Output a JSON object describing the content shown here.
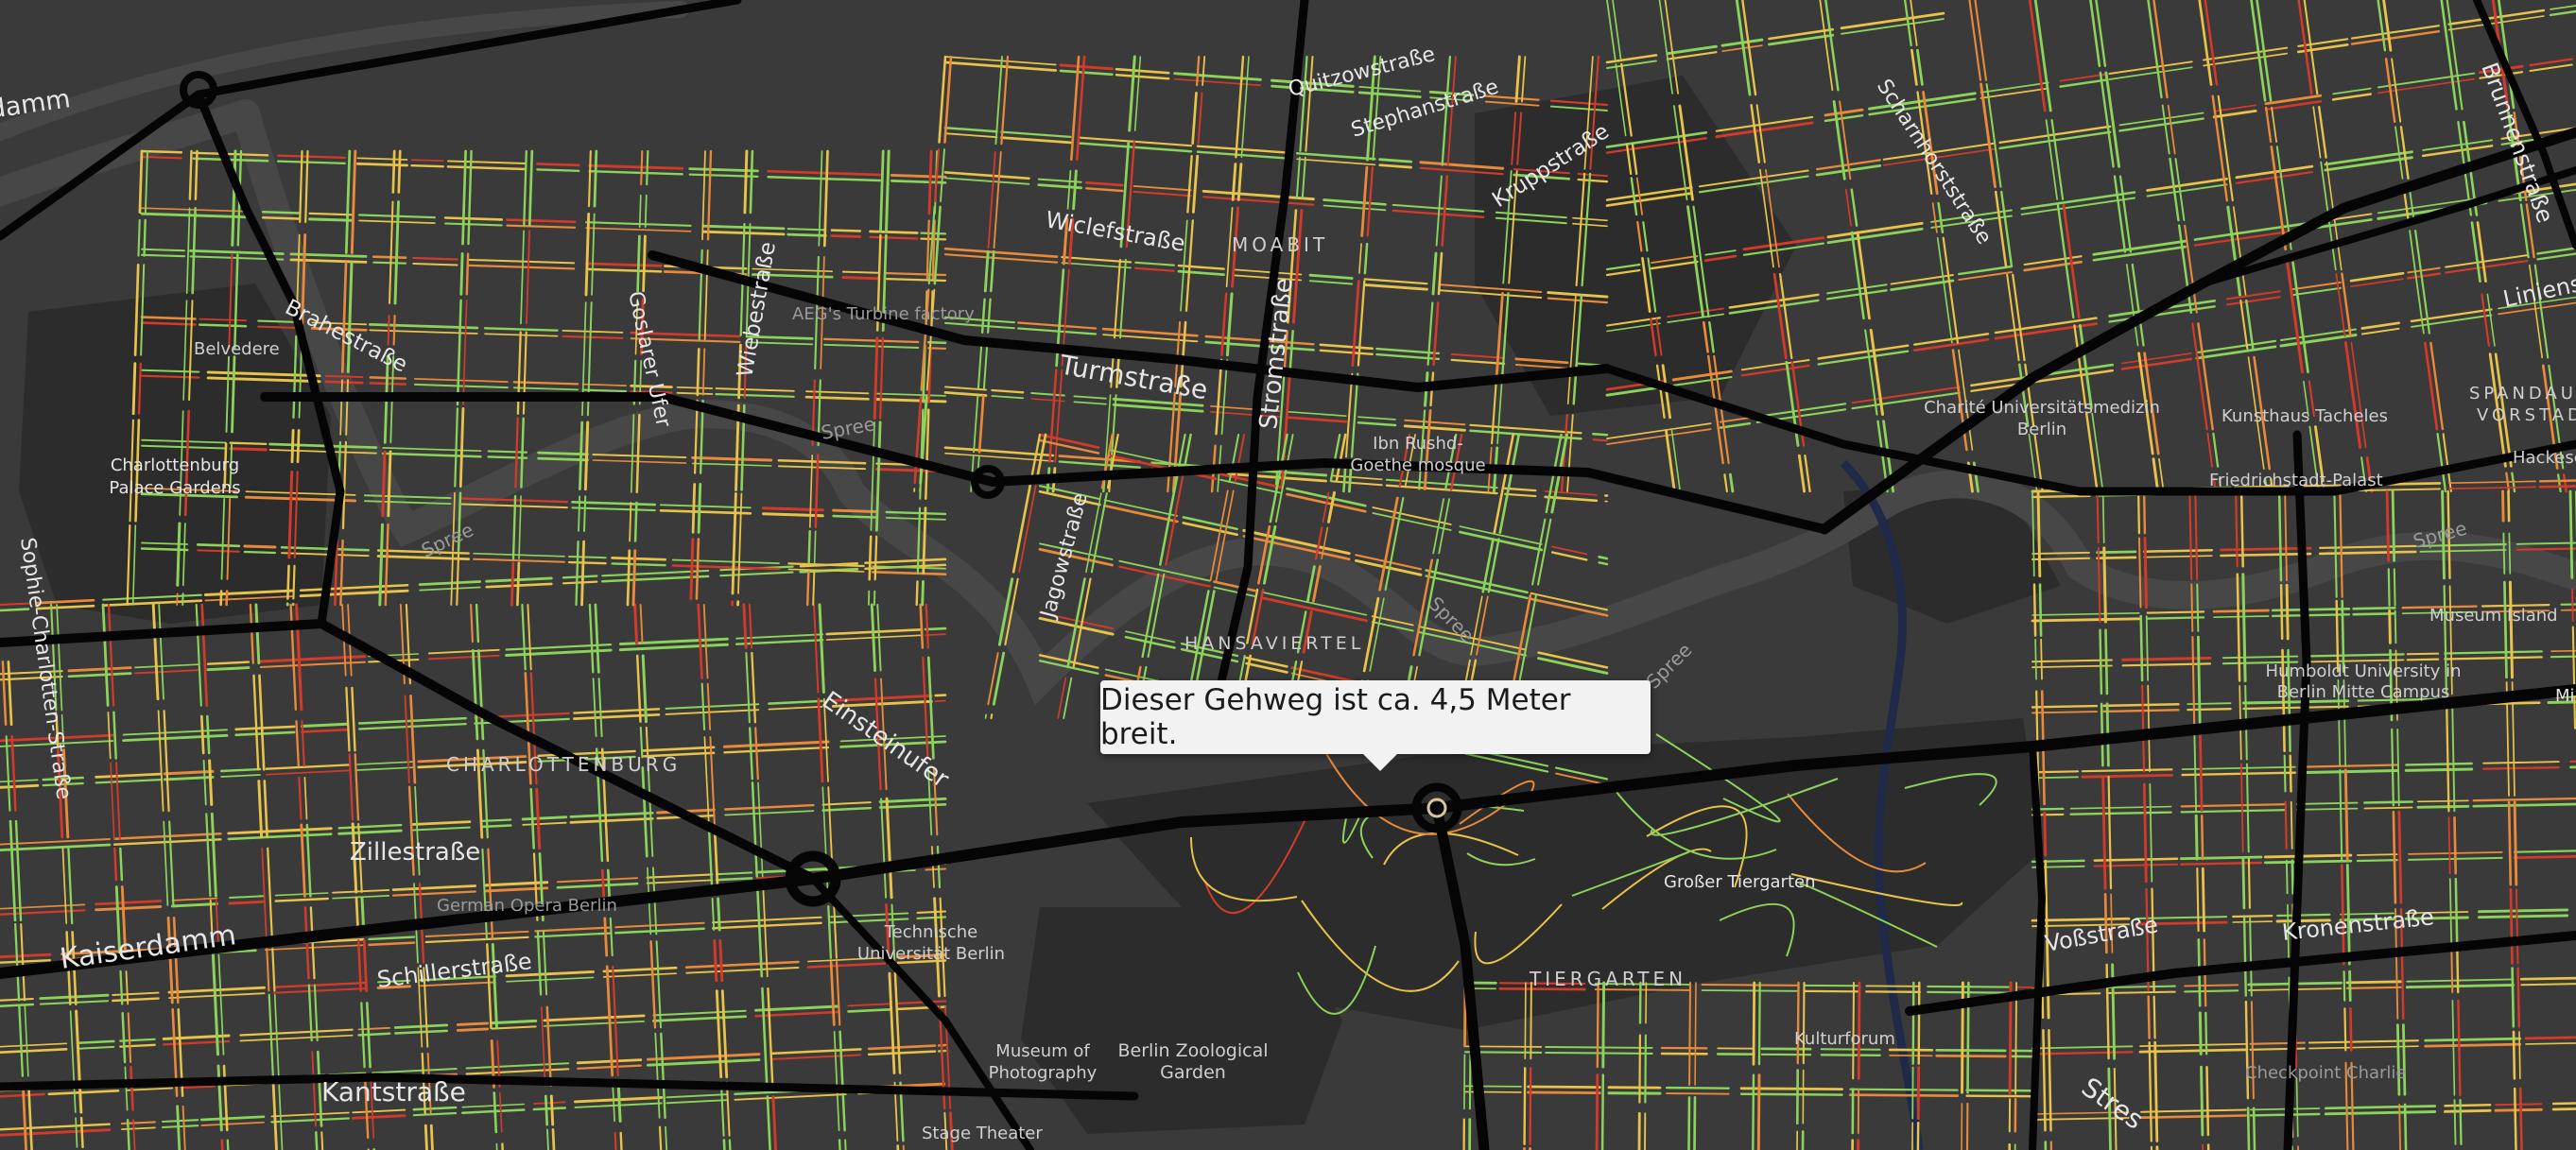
{
  "tooltip": {
    "text": "Dieser Gehweg ist ca. 4,5 Meter breit."
  },
  "colors": {
    "background": "#3a3a3a",
    "park": "#2b2b2b",
    "water": "#464646",
    "canal": "#1f2a44",
    "major_road": "#000000",
    "sidewalk_green": "#8bd35a",
    "sidewalk_yellow": "#e8c34a",
    "sidewalk_orange": "#e88a3a",
    "sidewalk_red": "#d43a2a"
  },
  "streets": {
    "kaiserdamm_top": "damm",
    "brahestrasse": "Brahestraße",
    "goslarer_ufer": "Goslarer Ufer",
    "wiebestrasse": "Wiebestraße",
    "wiclefstrasse": "Wiclefstraße",
    "quitzowstrasse": "Quitzowstraße",
    "stephanstrasse": "Stephanstraße",
    "kruppstrasse": "Kruppstraße",
    "scharnhorststrasse": "Scharnhorststraße",
    "brunnenstrasse": "Brunnenstraße",
    "linienstrasse": "Linienstraße",
    "turmstrasse": "Turmstraße",
    "stromstrasse": "Stromstraße",
    "jagowstrasse": "Jagowstraße",
    "einsteinufer": "Einsteinufer",
    "sophie_charlotten": "Sophie-Charlotten-Straße",
    "zillestrasse": "Zillestraße",
    "kaiserdamm": "Kaiserdamm",
    "schillerstrasse": "Schillerstraße",
    "kantstrasse": "Kantstraße",
    "vossstrasse": "Voßstraße",
    "kronenstrasse": "Kronenstraße",
    "stresemann": "Stres"
  },
  "places": {
    "moabit": "MOABIT",
    "aeg": "AEG's Turbine factory",
    "belvedere": "Belvedere",
    "charlottenburg_palace_1": "Charlottenburg",
    "charlottenburg_palace_2": "Palace Gardens",
    "spree_1": "Spree",
    "spree_2": "Spree",
    "spree_3": "Spree",
    "spree_4": "Spree",
    "spree_5": "Spree",
    "ibn_rushd_1": "Ibn Rushd-",
    "ibn_rushd_2": "Goethe mosque",
    "charite_1": "Charité Universitätsmedizin",
    "charite_2": "Berlin",
    "kunsthaus": "Kunsthaus Tacheles",
    "friedrichstadt": "Friedrichstadt-Palast",
    "spandauer_1": "SPANDAUE",
    "spandauer_2": "VORSTADT",
    "hackesch": "Hackesch",
    "museum_island": "Museum Island",
    "humboldt_1": "Humboldt University in",
    "humboldt_2": "Berlin Mitte Campus",
    "mi": "Mi",
    "hansaviertel": "HANSAVIERTEL",
    "charlottenburg": "CHARLOTTENBURG",
    "grosser_tiergarten": "Großer Tiergarten",
    "german_opera": "German Opera Berlin",
    "tu_1": "Technische",
    "tu_2": "Universität Berlin",
    "tiergarten": "TIERGARTEN",
    "kulturforum": "Kulturforum",
    "museum_photo_1": "Museum of",
    "museum_photo_2": "Photography",
    "zoo_1": "Berlin Zoological",
    "zoo_2": "Garden",
    "checkpoint": "Checkpoint Charlie",
    "stage_theater": "Stage Theater"
  }
}
